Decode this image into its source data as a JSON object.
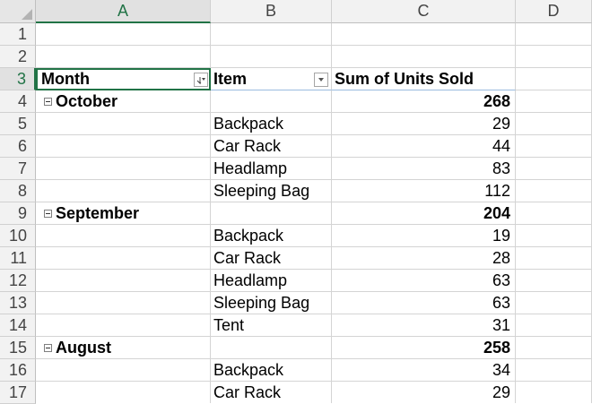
{
  "columns": [
    "A",
    "B",
    "C",
    "D"
  ],
  "rows": [
    "1",
    "2",
    "3",
    "4",
    "5",
    "6",
    "7",
    "8",
    "9",
    "10",
    "11",
    "12",
    "13",
    "14",
    "15",
    "16",
    "17"
  ],
  "header": {
    "month": "Month",
    "item": "Item",
    "sum": "Sum of Units Sold"
  },
  "icons": {
    "month_filter": "sort-filter-icon",
    "item_filter": "filter-dropdown-icon",
    "collapse": "collapse-minus-icon"
  },
  "colors": {
    "selection_green": "#217346",
    "header_border": "#9bbbe0"
  },
  "pivot": [
    {
      "type": "group",
      "label": "October",
      "total": "268"
    },
    {
      "type": "item",
      "label": "Backpack",
      "value": "29"
    },
    {
      "type": "item",
      "label": "Car Rack",
      "value": "44"
    },
    {
      "type": "item",
      "label": "Headlamp",
      "value": "83"
    },
    {
      "type": "item",
      "label": "Sleeping Bag",
      "value": "112"
    },
    {
      "type": "group",
      "label": "September",
      "total": "204"
    },
    {
      "type": "item",
      "label": "Backpack",
      "value": "19"
    },
    {
      "type": "item",
      "label": "Car Rack",
      "value": "28"
    },
    {
      "type": "item",
      "label": "Headlamp",
      "value": "63"
    },
    {
      "type": "item",
      "label": "Sleeping Bag",
      "value": "63"
    },
    {
      "type": "item",
      "label": "Tent",
      "value": "31"
    },
    {
      "type": "group",
      "label": "August",
      "total": "258"
    },
    {
      "type": "item",
      "label": "Backpack",
      "value": "34"
    },
    {
      "type": "item",
      "label": "Car Rack",
      "value": "29"
    }
  ]
}
